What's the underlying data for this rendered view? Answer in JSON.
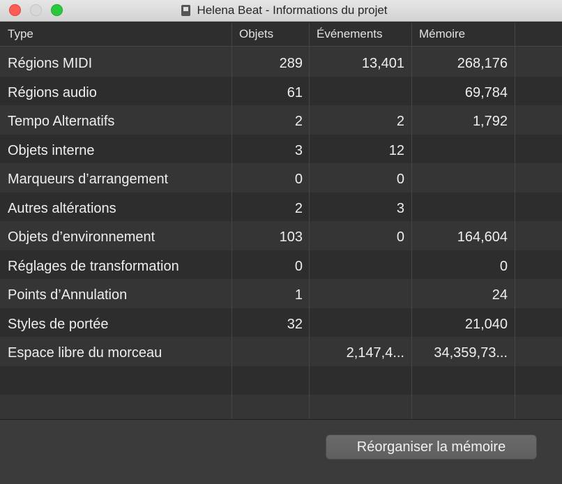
{
  "window": {
    "title": "Helena Beat - Informations du projet"
  },
  "table": {
    "headers": [
      "Type",
      "Objets",
      "Événements",
      "Mémoire"
    ],
    "rows": [
      {
        "type": "Régions MIDI",
        "objets": "289",
        "evenements": "13,401",
        "memoire": "268,176"
      },
      {
        "type": "Régions audio",
        "objets": "61",
        "evenements": "",
        "memoire": "69,784"
      },
      {
        "type": "Tempo Alternatifs",
        "objets": "2",
        "evenements": "2",
        "memoire": "1,792"
      },
      {
        "type": "Objets interne",
        "objets": "3",
        "evenements": "12",
        "memoire": ""
      },
      {
        "type": "Marqueurs d’arrangement",
        "objets": "0",
        "evenements": "0",
        "memoire": ""
      },
      {
        "type": "Autres altérations",
        "objets": "2",
        "evenements": "3",
        "memoire": ""
      },
      {
        "type": "Objets d’environnement",
        "objets": "103",
        "evenements": "0",
        "memoire": "164,604"
      },
      {
        "type": "Réglages de transformation",
        "objets": "0",
        "evenements": "",
        "memoire": "0"
      },
      {
        "type": "Points d’Annulation",
        "objets": "1",
        "evenements": "",
        "memoire": "24"
      },
      {
        "type": "Styles de portée",
        "objets": "32",
        "evenements": "",
        "memoire": "21,040"
      },
      {
        "type": "Espace libre du morceau",
        "objets": "",
        "evenements": "2,147,4...",
        "memoire": "34,359,73..."
      }
    ]
  },
  "footer": {
    "reorganize_label": "Réorganiser la mémoire"
  },
  "colors": {
    "close": "#fd5d55",
    "minimize": "#d8d8d8",
    "maximize": "#2ac840",
    "row_even": "#353535",
    "row_odd": "#2d2d2d"
  }
}
